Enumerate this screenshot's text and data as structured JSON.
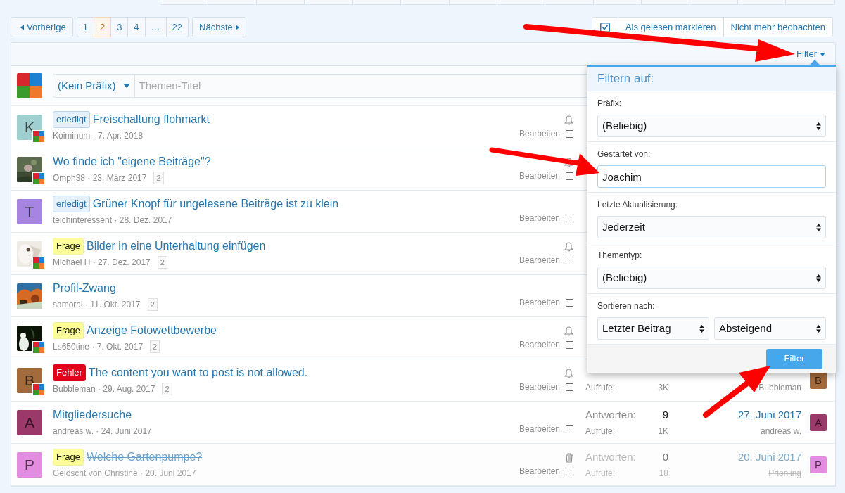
{
  "pagination": {
    "previous": "Vorherige",
    "pages": [
      {
        "label": "1",
        "selected": false
      },
      {
        "label": "2",
        "selected": true
      },
      {
        "label": "3",
        "selected": false
      },
      {
        "label": "4",
        "selected": false
      },
      {
        "label": "…",
        "selected": false
      },
      {
        "label": "22",
        "selected": false
      }
    ],
    "next": "Nächste"
  },
  "actions": [
    "Als gelesen markieren",
    "Nicht mehr beobachten"
  ],
  "filter_toggle": "Filter",
  "composer": {
    "prefix": "(Kein Präfix)",
    "placeholder": "Themen-Titel"
  },
  "threads": [
    {
      "kind": "watched",
      "avatar": {
        "kind": "letter",
        "letter": "K",
        "color": "#9fcfcf"
      },
      "badge": true,
      "prefix": {
        "kind": "done",
        "label": "erledigt"
      },
      "title": "Freischaltung flohmarkt",
      "byline": "Koiminum · 7. Apr. 2018",
      "edit": "Bearbeiten",
      "checked": false
    },
    {
      "kind": "watched",
      "badge": true,
      "title": "Wo finde ich \"eigene Beiträge\"?",
      "byline": "Omph38 · 23. März 2017",
      "pages": "2",
      "edit": "Bearbeiten",
      "checked": false
    },
    {
      "kind": "plain",
      "avatar": {
        "kind": "letter",
        "letter": "T",
        "color": "#a685e0"
      },
      "badge": false,
      "prefix": {
        "kind": "done",
        "label": "erledigt"
      },
      "title": "Grüner Knopf für ungelesene Beiträge ist zu klein",
      "byline": "teichinteressent · 28. Dez. 2017",
      "edit": "Bearbeiten",
      "checked": false
    },
    {
      "kind": "watched",
      "badge": true,
      "prefix": {
        "kind": "question",
        "label": "Frage"
      },
      "title": "Bilder in eine Unterhaltung einfügen",
      "byline": "Michael H · 27. Dez. 2017",
      "pages": "2",
      "edit": "Bearbeiten",
      "checked": false
    },
    {
      "kind": "plain",
      "badge": false,
      "title": "Profil-Zwang",
      "byline": "samorai · 11. Okt. 2017",
      "pages": "2",
      "edit": "Bearbeiten",
      "checked": false
    },
    {
      "kind": "watched",
      "badge": true,
      "prefix": {
        "kind": "question",
        "label": "Frage"
      },
      "title": "Anzeige Fotowettbewerbe",
      "byline": "Ls650tine · 7. Okt. 2017",
      "pages": "2",
      "edit": "Bearbeiten",
      "checked": false
    },
    {
      "kind": "watched",
      "avatar": {
        "kind": "letter",
        "letter": "B",
        "color": "#a36a3c"
      },
      "badge": true,
      "prefix": {
        "kind": "error",
        "label": "Fehler"
      },
      "title": "The content you want to post is not allowed.",
      "byline": "Bubbleman · 29. Aug. 2017",
      "pages": "2",
      "edit": "Bearbeiten",
      "checked": false,
      "stats": {
        "views_label": "Aufrufe:",
        "views": "3K",
        "last_user": "Bubbleman",
        "last_avatar": {
          "letter": "B",
          "color": "#a36a3c"
        }
      }
    },
    {
      "kind": "plain",
      "avatar": {
        "kind": "letter",
        "letter": "A",
        "color": "#9b3a6a"
      },
      "badge": false,
      "title": "Mitgliedersuche",
      "byline": "andreas w. · 24. Juni 2017",
      "edit": "Bearbeiten",
      "checked": false,
      "stats": {
        "replies_label": "Antworten:",
        "replies": "9",
        "views_label": "Aufrufe:",
        "views": "1K",
        "last_date": "27. Juni 2017",
        "last_user": "andreas w.",
        "last_avatar": {
          "letter": "A",
          "color": "#9b3a6a"
        }
      }
    },
    {
      "kind": "deleted",
      "avatar": {
        "kind": "letter",
        "letter": "P",
        "color": "#e38de0"
      },
      "badge": false,
      "prefix": {
        "kind": "question",
        "label": "Frage"
      },
      "title": "Welche Gartenpumpe?",
      "byline": "Gelöscht von Christine · 20. Juni 2017",
      "edit": "Bearbeiten",
      "checked": false,
      "stats": {
        "replies_label": "Antworten:",
        "replies": "0",
        "views_label": "Aufrufe:",
        "views": "18",
        "last_date": "20. Juni 2017",
        "last_user": "Prionling",
        "last_avatar": {
          "letter": "P",
          "color": "#e38de0"
        }
      }
    }
  ],
  "filter_menu": {
    "title": "Filtern auf:",
    "fields": [
      {
        "kind": "select",
        "label": "Präfix:",
        "values": [
          "(Beliebig)"
        ]
      },
      {
        "kind": "text",
        "label": "Gestartet von:",
        "values": [
          "Joachim"
        ]
      },
      {
        "kind": "select",
        "label": "Letzte Aktualisierung:",
        "values": [
          "Jederzeit"
        ]
      },
      {
        "kind": "select",
        "label": "Thementyp:",
        "values": [
          "(Beliebig)"
        ]
      },
      {
        "kind": "select-pair",
        "label": "Sortieren nach:",
        "values": [
          "Letzter Beitrag",
          "Absteigend"
        ]
      }
    ],
    "button": "Filter"
  }
}
